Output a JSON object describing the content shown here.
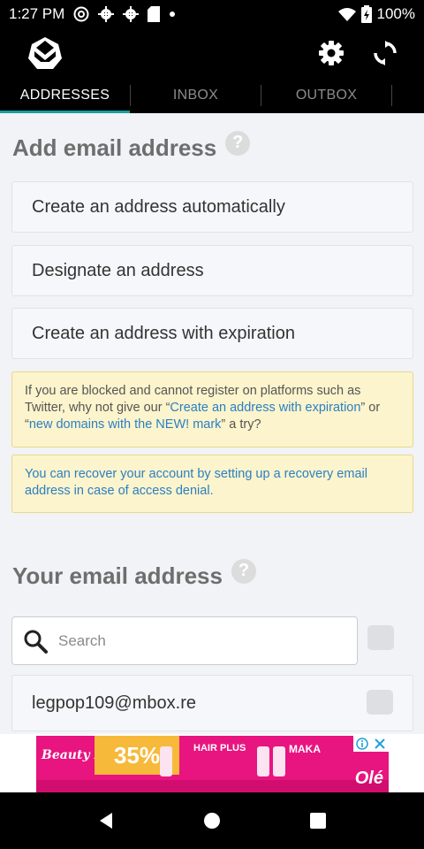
{
  "status_bar": {
    "time": "1:27 PM",
    "left_icons": [
      "at-sign-icon",
      "gear-icon",
      "gear-icon",
      "sd-card-icon",
      "dot-icon"
    ],
    "battery": "100%"
  },
  "app_bar": {
    "logo": "mbox-logo-icon",
    "actions": [
      "settings-icon",
      "refresh-icon"
    ]
  },
  "tabs": [
    {
      "label": "ADDRESSES",
      "active": true
    },
    {
      "label": "INBOX",
      "active": false
    },
    {
      "label": "OUTBOX",
      "active": false
    }
  ],
  "add_section": {
    "title": "Add email address",
    "help": "?",
    "options": [
      "Create an address automatically",
      "Designate an address",
      "Create an address with expiration"
    ]
  },
  "notice_1": {
    "text_before": "If you are blocked and cannot register on platforms such as Twitter, why not give our “",
    "link1": "Create an address with expiration",
    "text_middle": "” or “",
    "link2": "new domains with the NEW! mark",
    "text_after": "” a try?"
  },
  "notice_2": {
    "text": "You can recover your account by setting up a recovery email address in case of access denial."
  },
  "your_section": {
    "title": "Your email address",
    "help": "?",
    "search_placeholder": "Search",
    "emails": [
      "legpop109@mbox.re"
    ]
  },
  "ad": {
    "brand": "Beauty FEST! Olé",
    "discount": "35%",
    "product1": "HAIR PLUS",
    "product2": "MAKA",
    "logo": "Olé"
  },
  "colors": {
    "tab_indicator": "#16a0a0",
    "link": "#2b7fc3",
    "notice_bg": "#fcf4cc",
    "ad_bg": "#e8147f"
  }
}
